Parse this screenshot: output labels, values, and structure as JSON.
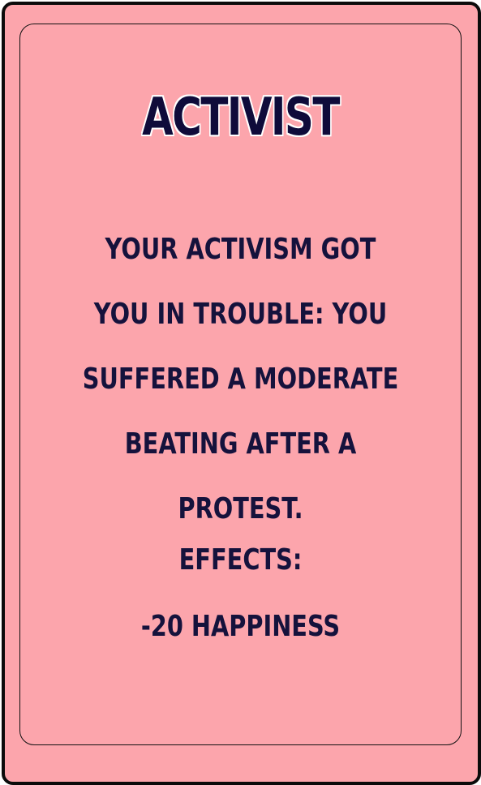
{
  "card": {
    "title": "ACTIVIST",
    "description": "YOUR ACTIVISM GOT YOU IN TROUBLE: YOU SUFFERED A MODERATE BEATING AFTER A PROTEST.",
    "effects_label": "EFFECTS:",
    "effects": [
      "-20 HAPPINESS"
    ]
  },
  "colors": {
    "card_background": "#fca5ac",
    "text": "#15123c",
    "border": "#0b0b0b"
  }
}
